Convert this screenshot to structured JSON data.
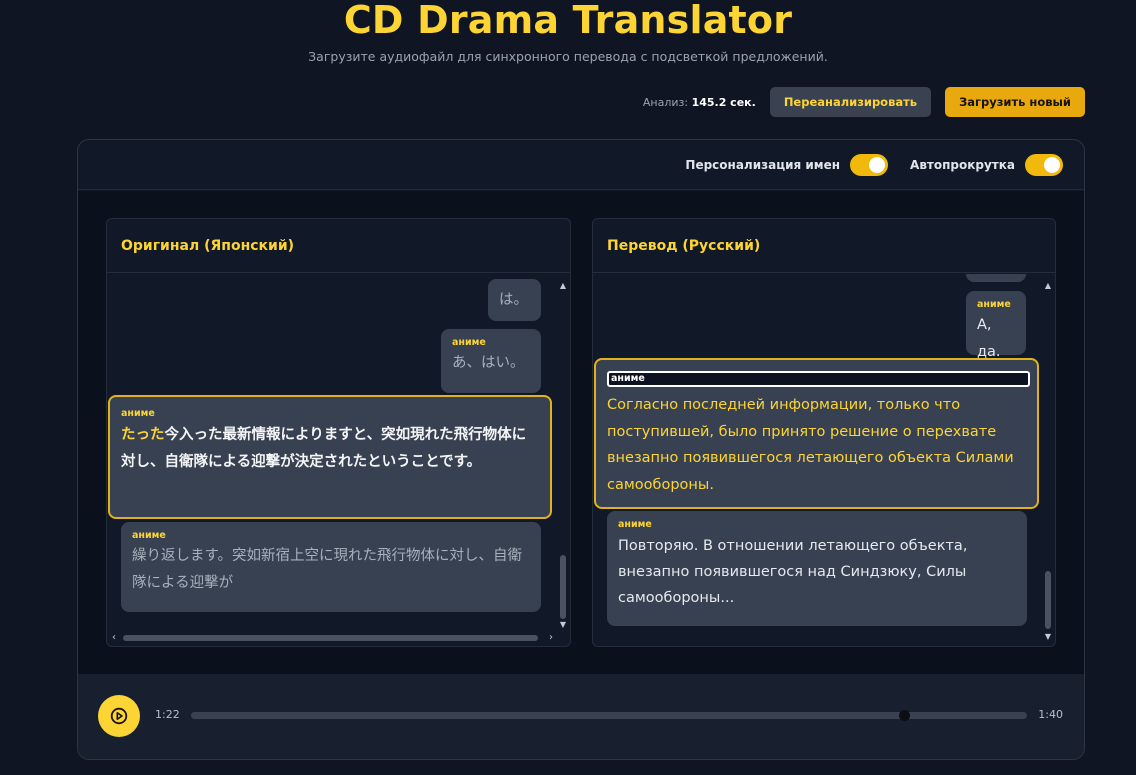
{
  "header": {
    "title": "CD Drama Translator",
    "subtitle": "Загрузите аудиофайл для синхронного перевода с подсветкой предложений."
  },
  "toolbar": {
    "analysis_label": "Анализ:",
    "analysis_value": "145.2 сек.",
    "reanalyze_label": "Переанализировать",
    "upload_label": "Загрузить новый"
  },
  "settings": {
    "name_personalization_label": "Персонализация имен",
    "name_personalization_on": true,
    "autoscroll_label": "Автопрокрутка",
    "autoscroll_on": true
  },
  "original": {
    "title": "Оригинал (Японский)",
    "lines": [
      {
        "speaker": "",
        "text": "は。"
      },
      {
        "speaker": "аниме",
        "text": "あ、はい。"
      },
      {
        "speaker": "аниме",
        "highlight": "たった",
        "text": "今入った最新情報によりますと、突如現れた飛行物体に対し、自衛隊による迎撃が決定されたということです。"
      },
      {
        "speaker": "аниме",
        "text": "繰り返します。突如新宿上空に現れた飛行物体に対し、自衛隊による迎撃が"
      }
    ]
  },
  "translation": {
    "title": "Перевод (Русский)",
    "lines": [
      {
        "speaker": "аниме",
        "text": "А, да."
      },
      {
        "speaker": "аниме",
        "text": "Согласно последней информации, только что поступившей, было принято решение о перехвате внезапно появившегося летающего объекта Силами самообороны."
      },
      {
        "speaker": "аниме",
        "text": "Повторяю. В отношении летающего объекта, внезапно появившегося над Синдзюку, Силы самообороны..."
      }
    ]
  },
  "player": {
    "current_time": "1:22",
    "total_time": "1:40",
    "progress": 0.82
  },
  "colors": {
    "accent": "#fcd535",
    "background": "#0f1522",
    "bubble": "#384151"
  }
}
